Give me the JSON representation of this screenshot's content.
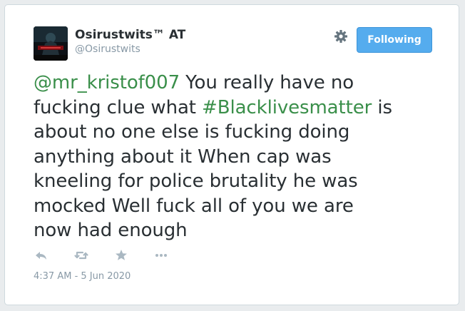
{
  "user": {
    "display_name": "Osirustwits™ AT",
    "handle": "@Osirustwits",
    "avatar_icon": "profile-avatar"
  },
  "header": {
    "settings_icon": "gear-icon",
    "follow_label": "Following",
    "follow_color": "#55acee"
  },
  "tweet": {
    "line1_mention": "@mr_kristof007",
    "line1_rest": " You really have no",
    "line2_pre": "fucking clue what ",
    "line2_hashtag": "#Blacklivesmatter",
    "line2_post": " is",
    "line3": "about no one else is fucking doing",
    "line4": "anything about it When cap was",
    "line5": "kneeling for police brutality he was",
    "line6": "mocked Well fuck all of you we are",
    "line7": "now had enough",
    "link_color": "#3a8f4a"
  },
  "actions": {
    "icons": [
      "reply-icon",
      "retweet-icon",
      "favorite-icon",
      "more-icon"
    ]
  },
  "timestamp": "4:37 AM - 5 Jun 2020"
}
